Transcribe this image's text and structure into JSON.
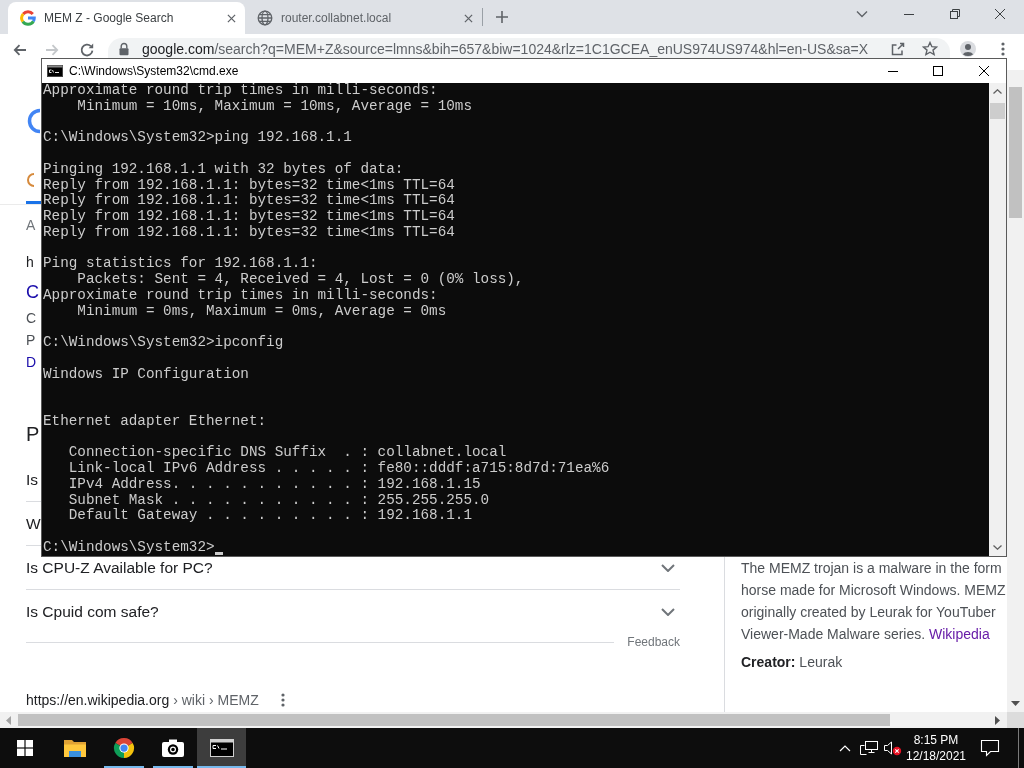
{
  "tabs": [
    {
      "title": "MEM Z - Google Search",
      "kind": "search",
      "selected": true
    },
    {
      "title": "router.collabnet.local",
      "kind": "web",
      "selected": false
    }
  ],
  "toolbar": {
    "nav": [
      {
        "kind": "back",
        "disabled": false
      },
      {
        "kind": "forward",
        "disabled": true
      },
      {
        "kind": "reload",
        "disabled": false
      }
    ],
    "url": "google.com/search?q=MEM+Z&source=lmns&bih=657&biw=1024&rlz=1C1GCEA_enUS974US974&hl=en-US&sa=X"
  },
  "page": {
    "results_stats": "A",
    "result": {
      "url": "h",
      "title": "C",
      "snippet": [
        "C",
        "P"
      ],
      "link": "D"
    },
    "people_also_ask": {
      "heading": "P",
      "questions": [
        {
          "text": "Is"
        },
        {
          "text": "W"
        },
        {
          "text": "Is CPU-Z Available for PC?",
          "expanded": false
        },
        {
          "text": "Is Cpuid com safe?",
          "expanded": false
        }
      ],
      "feedback": "Feedback"
    },
    "next_result": {
      "site": "https://en.wikipedia.org",
      "path": "› wiki › MEMZ"
    },
    "knowledge_panel": {
      "lines": [
        "The MEMZ trojan is a malware in the form",
        "horse made for Microsoft Windows. MEMZ",
        "originally created by Leurak for YouTuber"
      ],
      "last_line": "Viewer-Made Malware series.",
      "source": "Wikipedia",
      "fact": "**Creator:** Leurak"
    }
  },
  "console": {
    "title": "C:\\Windows\\System32\\cmd.exe",
    "lines": [
      {
        "kind": "plain",
        "text": "Approximate round trip times in milli-seconds:"
      },
      {
        "kind": "indent",
        "text": "Minimum = 10ms, Maximum = 10ms, Average = 10ms"
      },
      {
        "kind": "blank"
      },
      {
        "kind": "plain",
        "text": "C:\\Windows\\System32>ping 192.168.1.1"
      },
      {
        "kind": "blank"
      },
      {
        "kind": "plain",
        "text": "Pinging 192.168.1.1 with 32 bytes of data:"
      },
      {
        "kind": "plain",
        "text": "Reply from 192.168.1.1: bytes=32 time<1ms TTL=64"
      },
      {
        "kind": "plain",
        "text": "Reply from 192.168.1.1: bytes=32 time<1ms TTL=64"
      },
      {
        "kind": "plain",
        "text": "Reply from 192.168.1.1: bytes=32 time<1ms TTL=64"
      },
      {
        "kind": "plain",
        "text": "Reply from 192.168.1.1: bytes=32 time<1ms TTL=64"
      },
      {
        "kind": "blank"
      },
      {
        "kind": "plain",
        "text": "Ping statistics for 192.168.1.1:"
      },
      {
        "kind": "indent",
        "text": "Packets: Sent = 4, Received = 4, Lost = 0 (0% loss),"
      },
      {
        "kind": "plain",
        "text": "Approximate round trip times in milli-seconds:"
      },
      {
        "kind": "indent",
        "text": "Minimum = 0ms, Maximum = 0ms, Average = 0ms"
      },
      {
        "kind": "blank"
      },
      {
        "kind": "plain",
        "text": "C:\\Windows\\System32>ipconfig"
      },
      {
        "kind": "blank"
      },
      {
        "kind": "plain",
        "text": "Windows IP Configuration"
      },
      {
        "kind": "blank"
      },
      {
        "kind": "blank"
      },
      {
        "kind": "plain",
        "text": "Ethernet adapter Ethernet:"
      },
      {
        "kind": "blank"
      },
      {
        "kind": "field",
        "text": "Connection-specific DNS Suffix  . : collabnet.local"
      },
      {
        "kind": "field",
        "text": "Link-local IPv6 Address . . . . . : fe80::dddf:a715:8d7d:71ea%6"
      },
      {
        "kind": "field",
        "text": "IPv4 Address. . . . . . . . . . . : 192.168.1.15"
      },
      {
        "kind": "field",
        "text": "Subnet Mask . . . . . . . . . . . : 255.255.255.0"
      },
      {
        "kind": "field",
        "text": "Default Gateway . . . . . . . . . : 192.168.1.1"
      },
      {
        "kind": "blank"
      },
      {
        "kind": "plain",
        "text": "C:\\Windows\\System32>"
      }
    ],
    "cursor": true
  },
  "taskbar": {
    "apps": [
      {
        "kind": "folder",
        "running": false,
        "selected": false
      },
      {
        "kind": "browser",
        "running": true,
        "selected": false
      },
      {
        "kind": "camera",
        "running": true,
        "selected": false
      },
      {
        "kind": "terminal",
        "running": true,
        "selected": true
      }
    ],
    "clock": {
      "time": "8:15 PM",
      "date": "12/18/2021"
    },
    "volume_muted": true
  }
}
